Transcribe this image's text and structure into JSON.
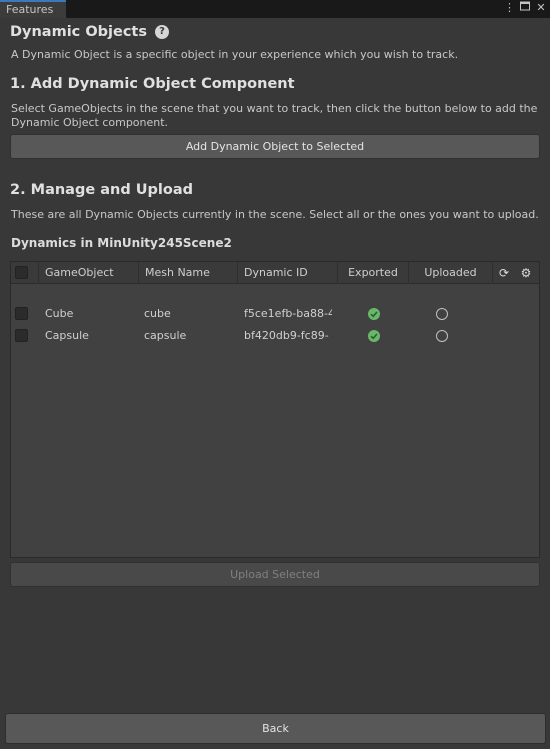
{
  "window": {
    "tab_label": "Features",
    "icons": [
      "more-vert-icon",
      "maximize-icon",
      "close-icon"
    ]
  },
  "header": {
    "title": "Dynamic Objects",
    "help_icon": "?",
    "description": "A Dynamic Object is a specific object in your experience which you wish to track."
  },
  "section1": {
    "title": "1. Add Dynamic Object Component",
    "description_line1": "Select GameObjects in the scene that you want to track, then click the button below to add the",
    "description_line2": "Dynamic Object component.",
    "button_label": "Add Dynamic Object to Selected"
  },
  "section2": {
    "title": "2. Manage and Upload",
    "description": "These are all Dynamic Objects currently in the scene. Select all or the ones you want to upload."
  },
  "dynamics": {
    "title": "Dynamics in MinUnity245Scene2",
    "columns": [
      "GameObject",
      "Mesh Name",
      "Dynamic ID",
      "Exported",
      "Uploaded"
    ],
    "rows": [
      {
        "game_object": "Cube",
        "mesh_name": "cube",
        "dynamic_id": "f5ce1efb-ba88-4",
        "exported": "check-circle-icon",
        "uploaded": "circle-outline-icon"
      },
      {
        "game_object": "Capsule",
        "mesh_name": "capsule",
        "dynamic_id": "bf420db9-fc89-",
        "exported": "check-circle-icon",
        "uploaded": "circle-outline-icon"
      }
    ],
    "refresh_icon": "⟳",
    "settings_icon": "⚙"
  },
  "footer": {
    "upload_label": "Upload Selected",
    "back_label": "Back"
  },
  "colors": {
    "background": "#383838",
    "accent_tab": "#3a79bb",
    "exported_ok": "#69b86a",
    "button": "#585858"
  }
}
